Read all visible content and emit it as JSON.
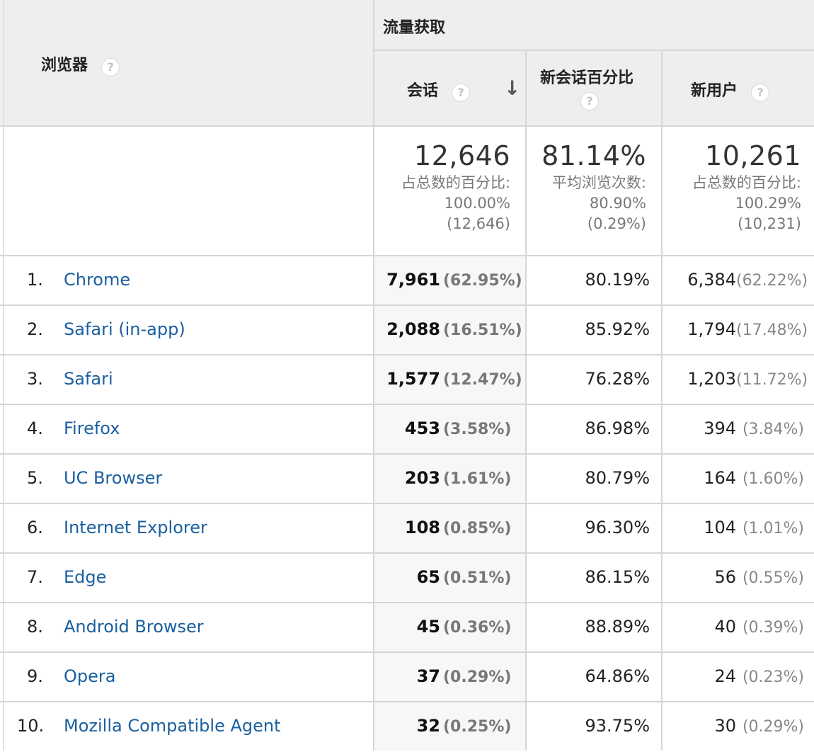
{
  "header": {
    "browser_label": "浏览器",
    "group_label": "流量获取",
    "col_sessions": "会话",
    "col_new_session_pct": "新会话百分比",
    "col_new_users": "新用户",
    "help_glyph": "?",
    "sort_glyph": "↓"
  },
  "totals": {
    "sessions": {
      "value": "12,646",
      "caption": "占总数的百分比:",
      "pct": "100.00%",
      "of": "(12,646)"
    },
    "new_session_pct": {
      "value": "81.14%",
      "caption": "平均浏览次数:",
      "pct": "80.90%",
      "of": "(0.29%)"
    },
    "new_users": {
      "value": "10,261",
      "caption": "占总数的百分比:",
      "pct": "100.29%",
      "of": "(10,231)"
    }
  },
  "rows": [
    {
      "idx": "1.",
      "browser": "Chrome",
      "sessions": "7,961",
      "sessions_pct": "(62.95%)",
      "new_pct": "80.19%",
      "new_users": "6,384",
      "new_users_pct": "(62.22%)"
    },
    {
      "idx": "2.",
      "browser": "Safari (in-app)",
      "sessions": "2,088",
      "sessions_pct": "(16.51%)",
      "new_pct": "85.92%",
      "new_users": "1,794",
      "new_users_pct": "(17.48%)"
    },
    {
      "idx": "3.",
      "browser": "Safari",
      "sessions": "1,577",
      "sessions_pct": "(12.47%)",
      "new_pct": "76.28%",
      "new_users": "1,203",
      "new_users_pct": "(11.72%)"
    },
    {
      "idx": "4.",
      "browser": "Firefox",
      "sessions": "453",
      "sessions_pct": "(3.58%)",
      "new_pct": "86.98%",
      "new_users": "394",
      "new_users_pct": "(3.84%)"
    },
    {
      "idx": "5.",
      "browser": "UC Browser",
      "sessions": "203",
      "sessions_pct": "(1.61%)",
      "new_pct": "80.79%",
      "new_users": "164",
      "new_users_pct": "(1.60%)"
    },
    {
      "idx": "6.",
      "browser": "Internet Explorer",
      "sessions": "108",
      "sessions_pct": "(0.85%)",
      "new_pct": "96.30%",
      "new_users": "104",
      "new_users_pct": "(1.01%)"
    },
    {
      "idx": "7.",
      "browser": "Edge",
      "sessions": "65",
      "sessions_pct": "(0.51%)",
      "new_pct": "86.15%",
      "new_users": "56",
      "new_users_pct": "(0.55%)"
    },
    {
      "idx": "8.",
      "browser": "Android Browser",
      "sessions": "45",
      "sessions_pct": "(0.36%)",
      "new_pct": "88.89%",
      "new_users": "40",
      "new_users_pct": "(0.39%)"
    },
    {
      "idx": "9.",
      "browser": "Opera",
      "sessions": "37",
      "sessions_pct": "(0.29%)",
      "new_pct": "64.86%",
      "new_users": "24",
      "new_users_pct": "(0.23%)"
    },
    {
      "idx": "10.",
      "browser": "Mozilla Compatible Agent",
      "sessions": "32",
      "sessions_pct": "(0.25%)",
      "new_pct": "93.75%",
      "new_users": "30",
      "new_users_pct": "(0.29%)"
    }
  ]
}
